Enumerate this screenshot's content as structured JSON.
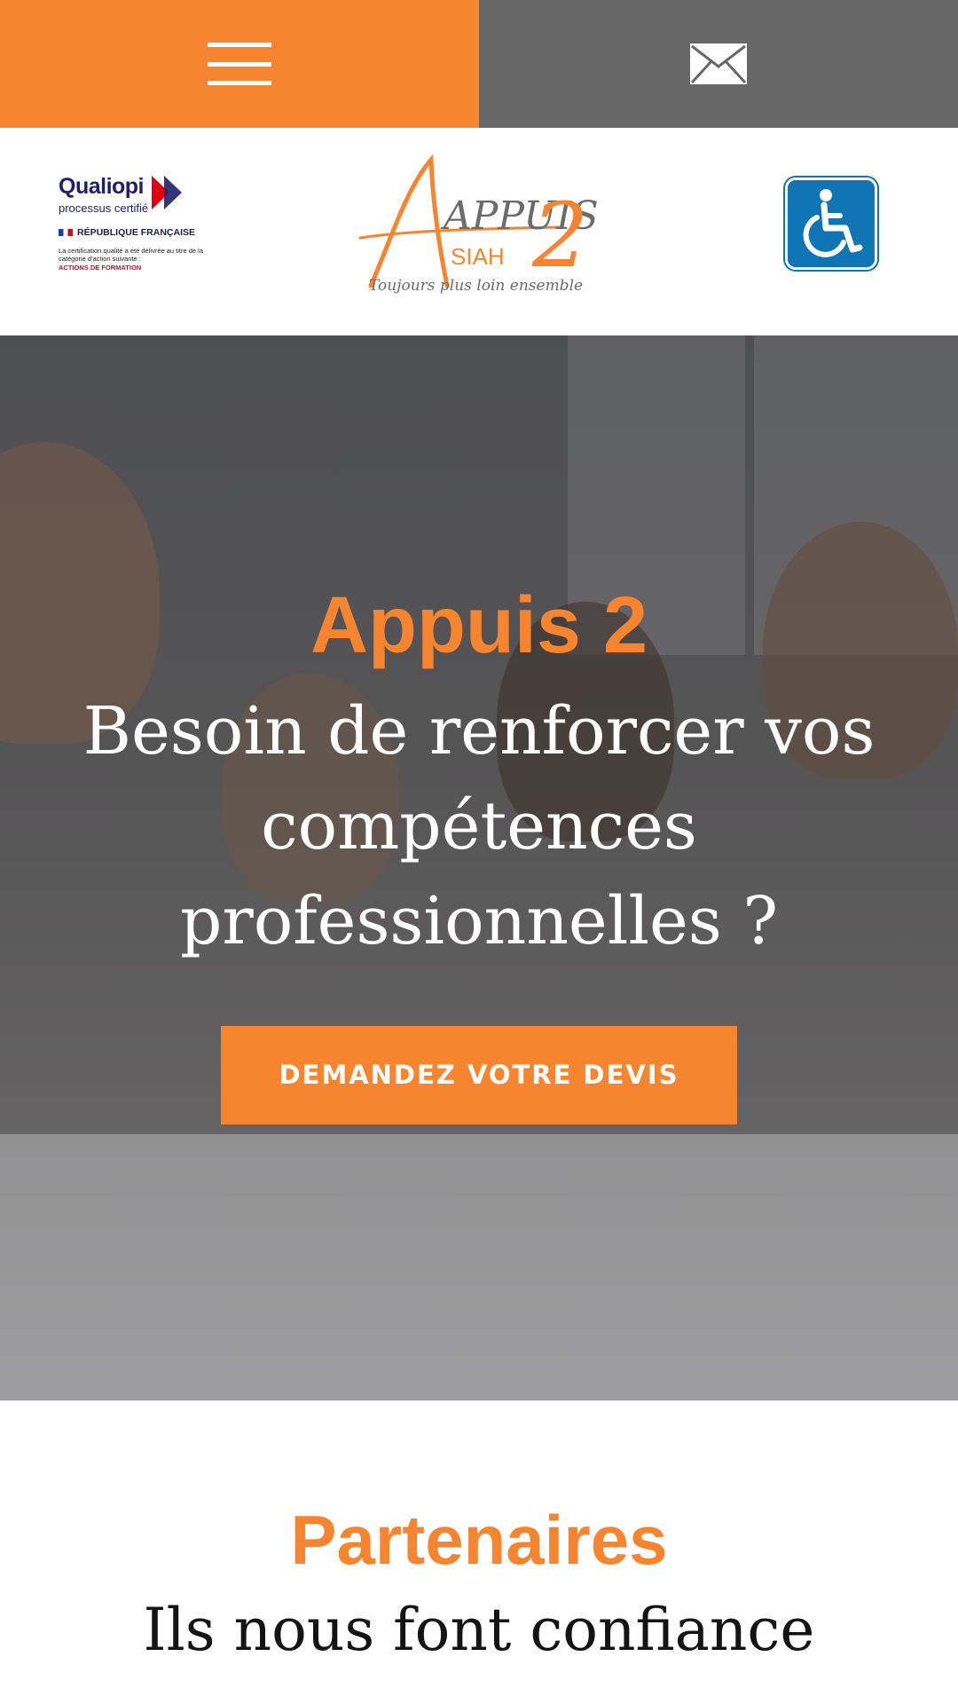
{
  "header": {
    "menu_icon": "hamburger-menu-icon",
    "mail_icon": "envelope-icon",
    "menu_color": "#f7852f",
    "mail_color": "#676767"
  },
  "logos": {
    "qualiopi": {
      "name": "Qualiopi",
      "subtitle": "processus certifié",
      "republic": "RÉPUBLIQUE FRANÇAISE",
      "description": "La certification qualité a été délivrée au titre de la catégorie d'action suivante :",
      "category": "ACTIONS DE FORMATION"
    },
    "brand": {
      "name": "APPUIS",
      "number": "2",
      "sub": "SIAH",
      "tagline": "Toujours plus loin ensemble"
    },
    "accessibility_icon": "wheelchair-icon",
    "accessibility_color": "#1075b4"
  },
  "hero": {
    "kicker": "Appuis 2",
    "title": "Besoin de renforcer vos compétences professionnelles ?",
    "cta_label": "DEMANDEZ VOTRE DEVIS"
  },
  "partners": {
    "title": "Partenaires",
    "subtitle": "Ils nous font confiance"
  },
  "colors": {
    "accent": "#f7852f",
    "text_dark": "#141414"
  }
}
